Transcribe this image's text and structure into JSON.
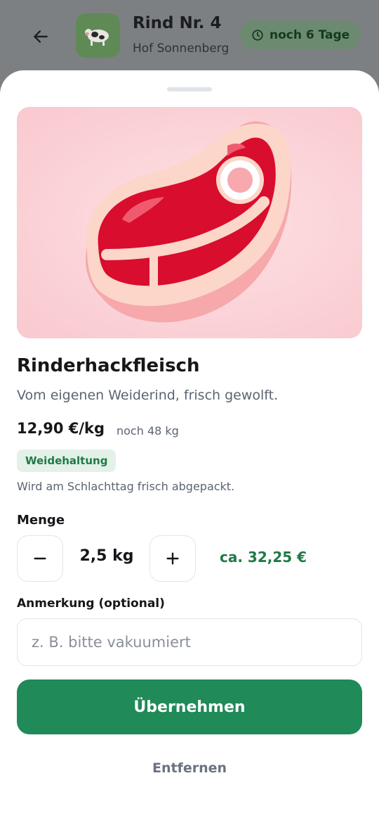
{
  "header": {
    "title": "Rind Nr. 4",
    "subtitle": "Hof Sonnenberg",
    "time_badge": "noch 6 Tage",
    "thumb_icon": "cow-icon",
    "back_icon": "arrow-left-icon"
  },
  "product": {
    "image_icon": "steak-icon",
    "name": "Rinderhackfleisch",
    "description": "Vom eigenen Weiderind, frisch gewolft.",
    "price": "12,90 €/kg",
    "stock": "noch 48 kg",
    "tag": "Weidehaltung",
    "note": "Wird am Schlachttag frisch abgepackt."
  },
  "quantity": {
    "label": "Menge",
    "value": "2,5 kg",
    "decrement_icon": "minus-icon",
    "increment_icon": "plus-icon",
    "total": "ca. 32,25 €"
  },
  "comment": {
    "label": "Anmerkung (optional)",
    "placeholder": "z. B. bitte vakuumiert",
    "value": ""
  },
  "actions": {
    "primary": "Übernehmen",
    "secondary": "Entfernen"
  },
  "colors": {
    "accent": "#208a58",
    "tag_bg": "#e3f1e8",
    "text": "#15171a",
    "muted": "#5b6472"
  }
}
